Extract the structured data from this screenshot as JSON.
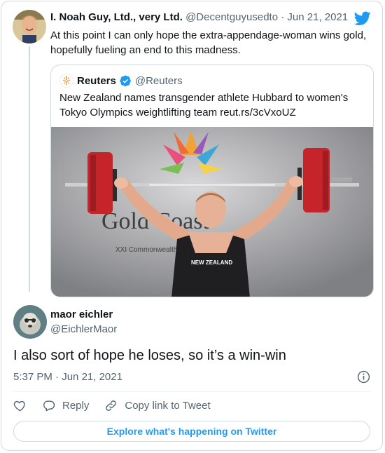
{
  "parent_tweet": {
    "author_name": "I. Noah Guy, Ltd., very Ltd.",
    "author_handle": "@Decentguyusedto",
    "separator": "·",
    "date": "Jun 21, 2021",
    "text": "At this point I can only hope the extra-appendage-woman wins gold, hopefully fueling an end to this madness."
  },
  "quoted_tweet": {
    "author_name": "Reuters",
    "author_handle": "@Reuters",
    "text": "New Zealand names transgender athlete Hubbard to women's Tokyo Olympics weightlifting team reut.rs/3cVxoUZ",
    "image": {
      "banner_text": "Gold Coast",
      "banner_sub": "XXI Commonwealth",
      "jersey_text": "NEW ZEALAND"
    }
  },
  "reply_tweet": {
    "author_name": "maor eichler",
    "author_handle": "@EichlerMaor",
    "text": "I also sort of hope he loses, so it’s a win-win",
    "time": "5:37 PM",
    "separator": "·",
    "date": "Jun 21, 2021"
  },
  "actions": {
    "like_icon": "heart-icon",
    "reply_label": "Reply",
    "copy_link_label": "Copy link to Tweet"
  },
  "explore_label": "Explore what's happening on Twitter",
  "colors": {
    "twitter_blue": "#1d9bf0",
    "text": "#0f1419",
    "muted": "#536471",
    "border": "#cfd9de"
  }
}
